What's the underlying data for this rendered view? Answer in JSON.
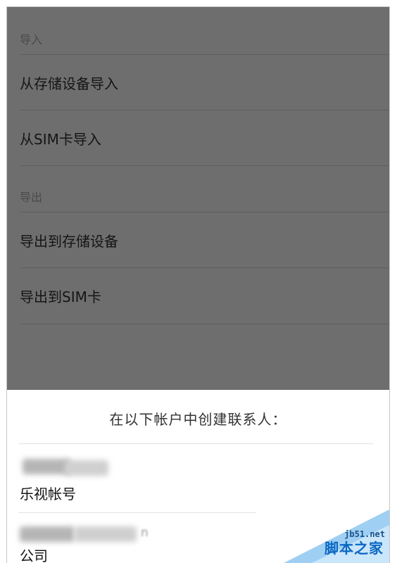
{
  "menu": {
    "import_header": "导入",
    "import_storage": "从存储设备导入",
    "import_sim": "从SIM卡导入",
    "export_header": "导出",
    "export_storage": "导出到存储设备",
    "export_sim": "导出到SIM卡"
  },
  "sheet": {
    "title": "在以下帐户中创建联系人：",
    "accounts": [
      {
        "label": "乐视帐号"
      },
      {
        "label": "公司",
        "partial_text": "n"
      }
    ]
  },
  "watermark": {
    "url": "jb51.net",
    "name": "脚本之家"
  },
  "colors": {
    "backdrop": "#6e6e6e",
    "sheet": "#ffffff",
    "watermark_blue": "#0b67c2"
  }
}
